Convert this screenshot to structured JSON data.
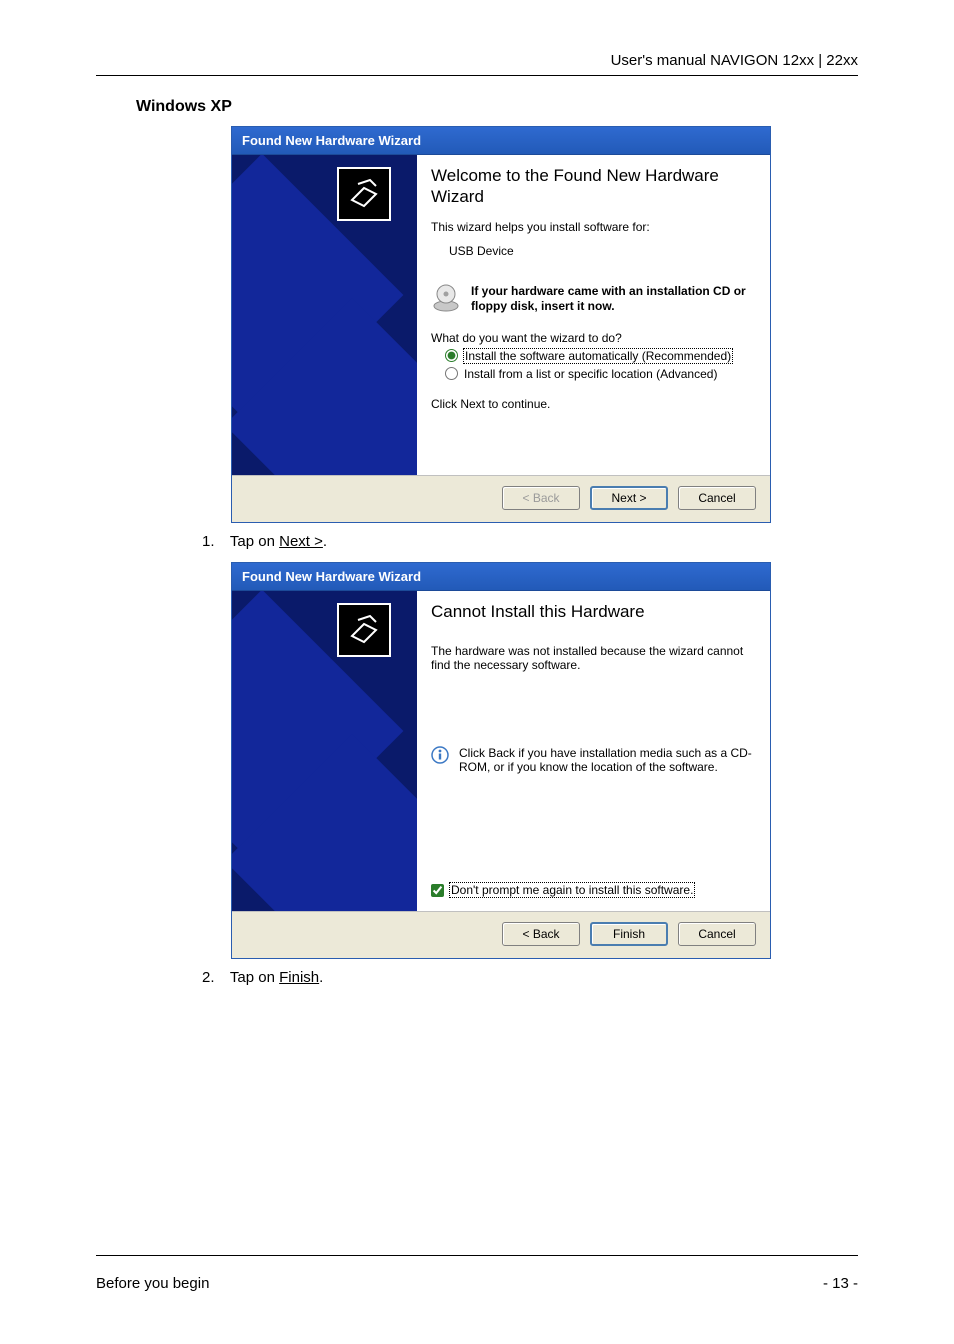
{
  "header": {
    "title": "User's manual NAVIGON 12xx | 22xx"
  },
  "section": {
    "heading": "Windows XP"
  },
  "dialog1": {
    "titlebar": "Found New Hardware Wizard",
    "heading": "Welcome to the Found New Hardware Wizard",
    "intro": "This wizard helps you install software for:",
    "device": "USB Device",
    "cd_hint": "If your hardware came with an installation CD or floppy disk, insert it now.",
    "question": "What do you want the wizard to do?",
    "radio1": "Install the software automatically (Recommended)",
    "radio2": "Install from a list or specific location (Advanced)",
    "continue": "Click Next to continue.",
    "buttons": {
      "back": "< Back",
      "next": "Next >",
      "cancel": "Cancel"
    }
  },
  "step1": {
    "num": "1.",
    "prefix": "Tap on ",
    "action": "Next >",
    "suffix": "."
  },
  "dialog2": {
    "titlebar": "Found New Hardware Wizard",
    "heading": "Cannot Install this Hardware",
    "msg": "The hardware was not installed because the wizard cannot find the necessary software.",
    "info": "Click Back if you have installation media such as a CD-ROM, or if you know the location of the software.",
    "checkbox": "Don't prompt me again to install this software.",
    "buttons": {
      "back": "< Back",
      "finish": "Finish",
      "cancel": "Cancel"
    }
  },
  "step2": {
    "num": "2.",
    "prefix": "Tap on ",
    "action": "Finish",
    "suffix": "."
  },
  "footer": {
    "left": "Before you begin",
    "right": "- 13 -"
  }
}
